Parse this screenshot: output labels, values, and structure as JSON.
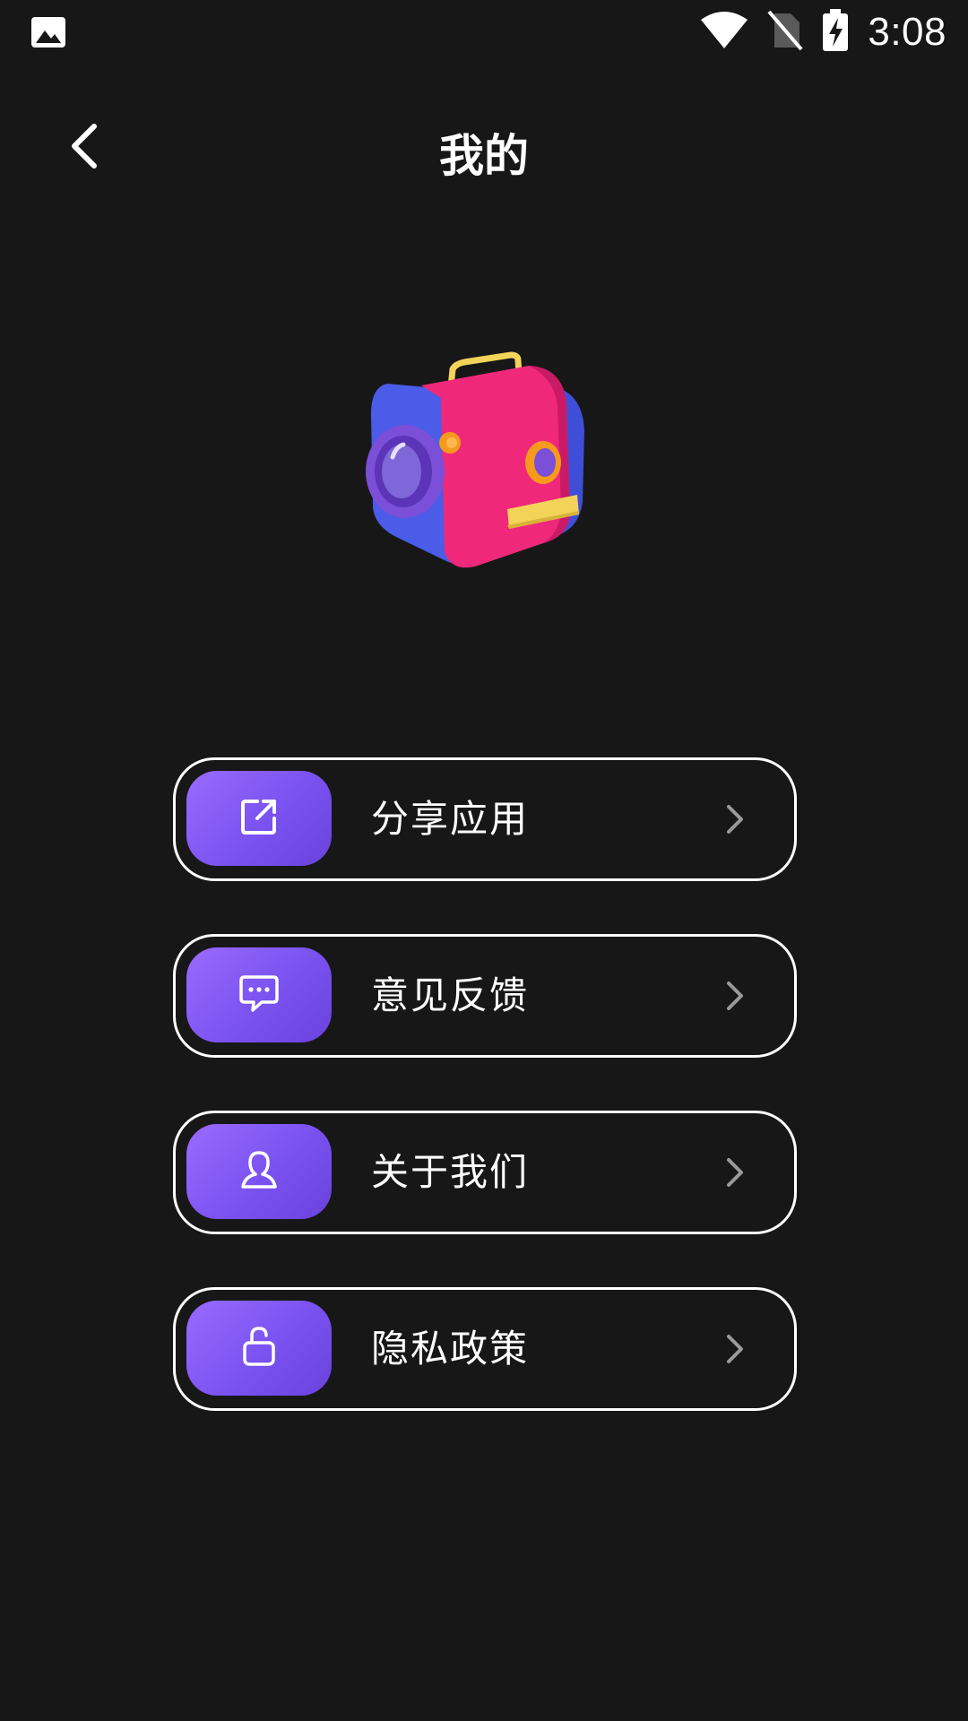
{
  "status_bar": {
    "time": "3:08",
    "icons": [
      "image-notification-icon",
      "wifi-icon",
      "no-sim-icon",
      "battery-charging-icon"
    ]
  },
  "header": {
    "title": "我的",
    "back_icon": "back-arrow-icon"
  },
  "hero": {
    "icon": "camera-3d-illustration",
    "colors": {
      "blue": "#4b5ce8",
      "pink": "#f0287a",
      "purple": "#7b4fd8",
      "yellow": "#f3d35a",
      "orange": "#f59a1c"
    }
  },
  "menu": {
    "items": [
      {
        "label": "分享应用",
        "icon": "share-icon"
      },
      {
        "label": "意见反馈",
        "icon": "feedback-chat-icon"
      },
      {
        "label": "关于我们",
        "icon": "user-icon"
      },
      {
        "label": "隐私政策",
        "icon": "unlock-icon"
      }
    ],
    "chevron_icon": "chevron-right-icon",
    "accent_color": "#8a5cf5"
  },
  "theme": {
    "background": "#171717",
    "text": "#ffffff",
    "border": "#ffffff"
  }
}
